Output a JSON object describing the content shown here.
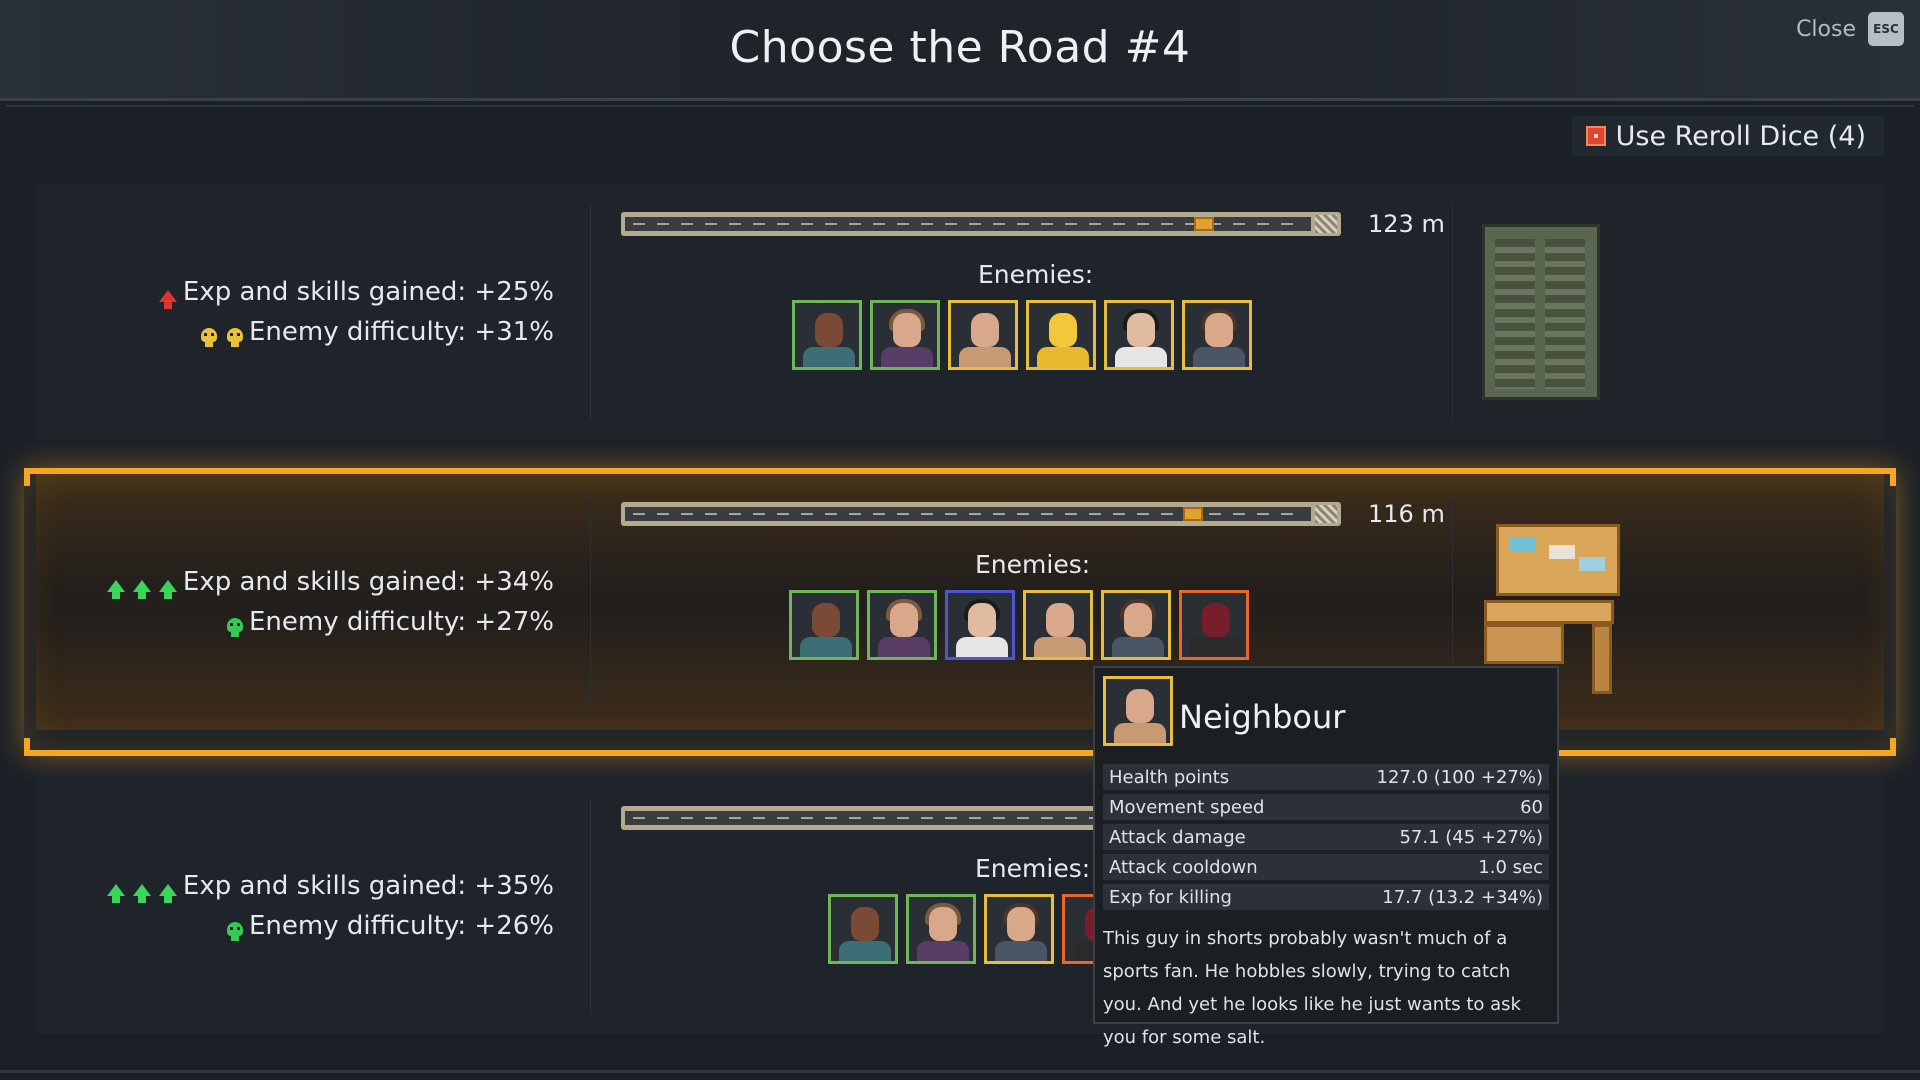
{
  "header": {
    "title": "Choose the Road #4",
    "close_label": "Close",
    "close_key": "ESC"
  },
  "reroll": {
    "label": "Use Reroll Dice (4)",
    "icon": "dice-icon"
  },
  "roads": [
    {
      "exp_label": "Exp and skills gained: +25%",
      "difficulty_label": "Enemy difficulty: +31%",
      "exp_arrows": 1,
      "exp_arrow_color": "#e0342f",
      "difficulty_skulls": 2,
      "difficulty_skull_color": "#e8c23a",
      "distance": "123 m",
      "progress": 0.8,
      "enemies_label": "Enemies:",
      "destination_icon": "locker-icon",
      "selected": false,
      "enemies": [
        {
          "icon": "thug-portrait-icon",
          "tier": "green"
        },
        {
          "icon": "woman-portrait-icon",
          "tier": "green"
        },
        {
          "icon": "bald-man-portrait-icon",
          "tier": "yellow"
        },
        {
          "icon": "hazmat-portrait-icon",
          "tier": "yellow"
        },
        {
          "icon": "dark-hair-woman-portrait-icon",
          "tier": "yellow"
        },
        {
          "icon": "man-portrait-icon",
          "tier": "yellow"
        }
      ]
    },
    {
      "exp_label": "Exp and skills gained: +34%",
      "difficulty_label": "Enemy difficulty: +27%",
      "exp_arrows": 3,
      "exp_arrow_color": "#3ad65a",
      "difficulty_skulls": 1,
      "difficulty_skull_color": "#36c956",
      "distance": "116 m",
      "progress": 0.78,
      "enemies_label": "Enemies:",
      "destination_icon": "desk-icon",
      "selected": true,
      "enemies": [
        {
          "icon": "thug-portrait-icon",
          "tier": "green"
        },
        {
          "icon": "woman-portrait-icon",
          "tier": "green"
        },
        {
          "icon": "dark-hair-woman-portrait-icon",
          "tier": "blue"
        },
        {
          "icon": "bald-man-portrait-icon",
          "tier": "yellow"
        },
        {
          "icon": "man-portrait-icon",
          "tier": "yellow"
        },
        {
          "icon": "masked-portrait-icon",
          "tier": "orange"
        }
      ]
    },
    {
      "exp_label": "Exp and skills gained: +35%",
      "difficulty_label": "Enemy difficulty: +26%",
      "exp_arrows": 3,
      "exp_arrow_color": "#3ad65a",
      "difficulty_skulls": 1,
      "difficulty_skull_color": "#36c956",
      "distance": "",
      "enemies_label": "Enemies:",
      "destination_icon": "",
      "selected": false,
      "enemies": [
        {
          "icon": "thug-portrait-icon",
          "tier": "green"
        },
        {
          "icon": "woman-portrait-icon",
          "tier": "green"
        },
        {
          "icon": "man-portrait-icon",
          "tier": "yellow"
        },
        {
          "icon": "masked-portrait-icon",
          "tier": "orange"
        }
      ]
    }
  ],
  "tooltip": {
    "name": "Neighbour",
    "icon": "bald-man-portrait-icon",
    "stats": [
      {
        "label": "Health points",
        "value": "127.0 (100 +27%)"
      },
      {
        "label": "Movement speed",
        "value": "60"
      },
      {
        "label": "Attack damage",
        "value": "57.1 (45 +27%)"
      },
      {
        "label": "Attack cooldown",
        "value": "1.0 sec"
      },
      {
        "label": "Exp for killing",
        "value": "17.7 (13.2 +34%)"
      }
    ],
    "description": "This guy in shorts probably wasn't much of a sports fan. He hobbles slowly, trying to catch you. And yet he looks like he just wants to ask you for some salt."
  },
  "colors": {
    "accent": "#f5a623",
    "tier_green": "#6fb65a",
    "tier_yellow": "#e7bd3c",
    "tier_blue": "#4b56d6",
    "tier_orange": "#e9672a"
  }
}
